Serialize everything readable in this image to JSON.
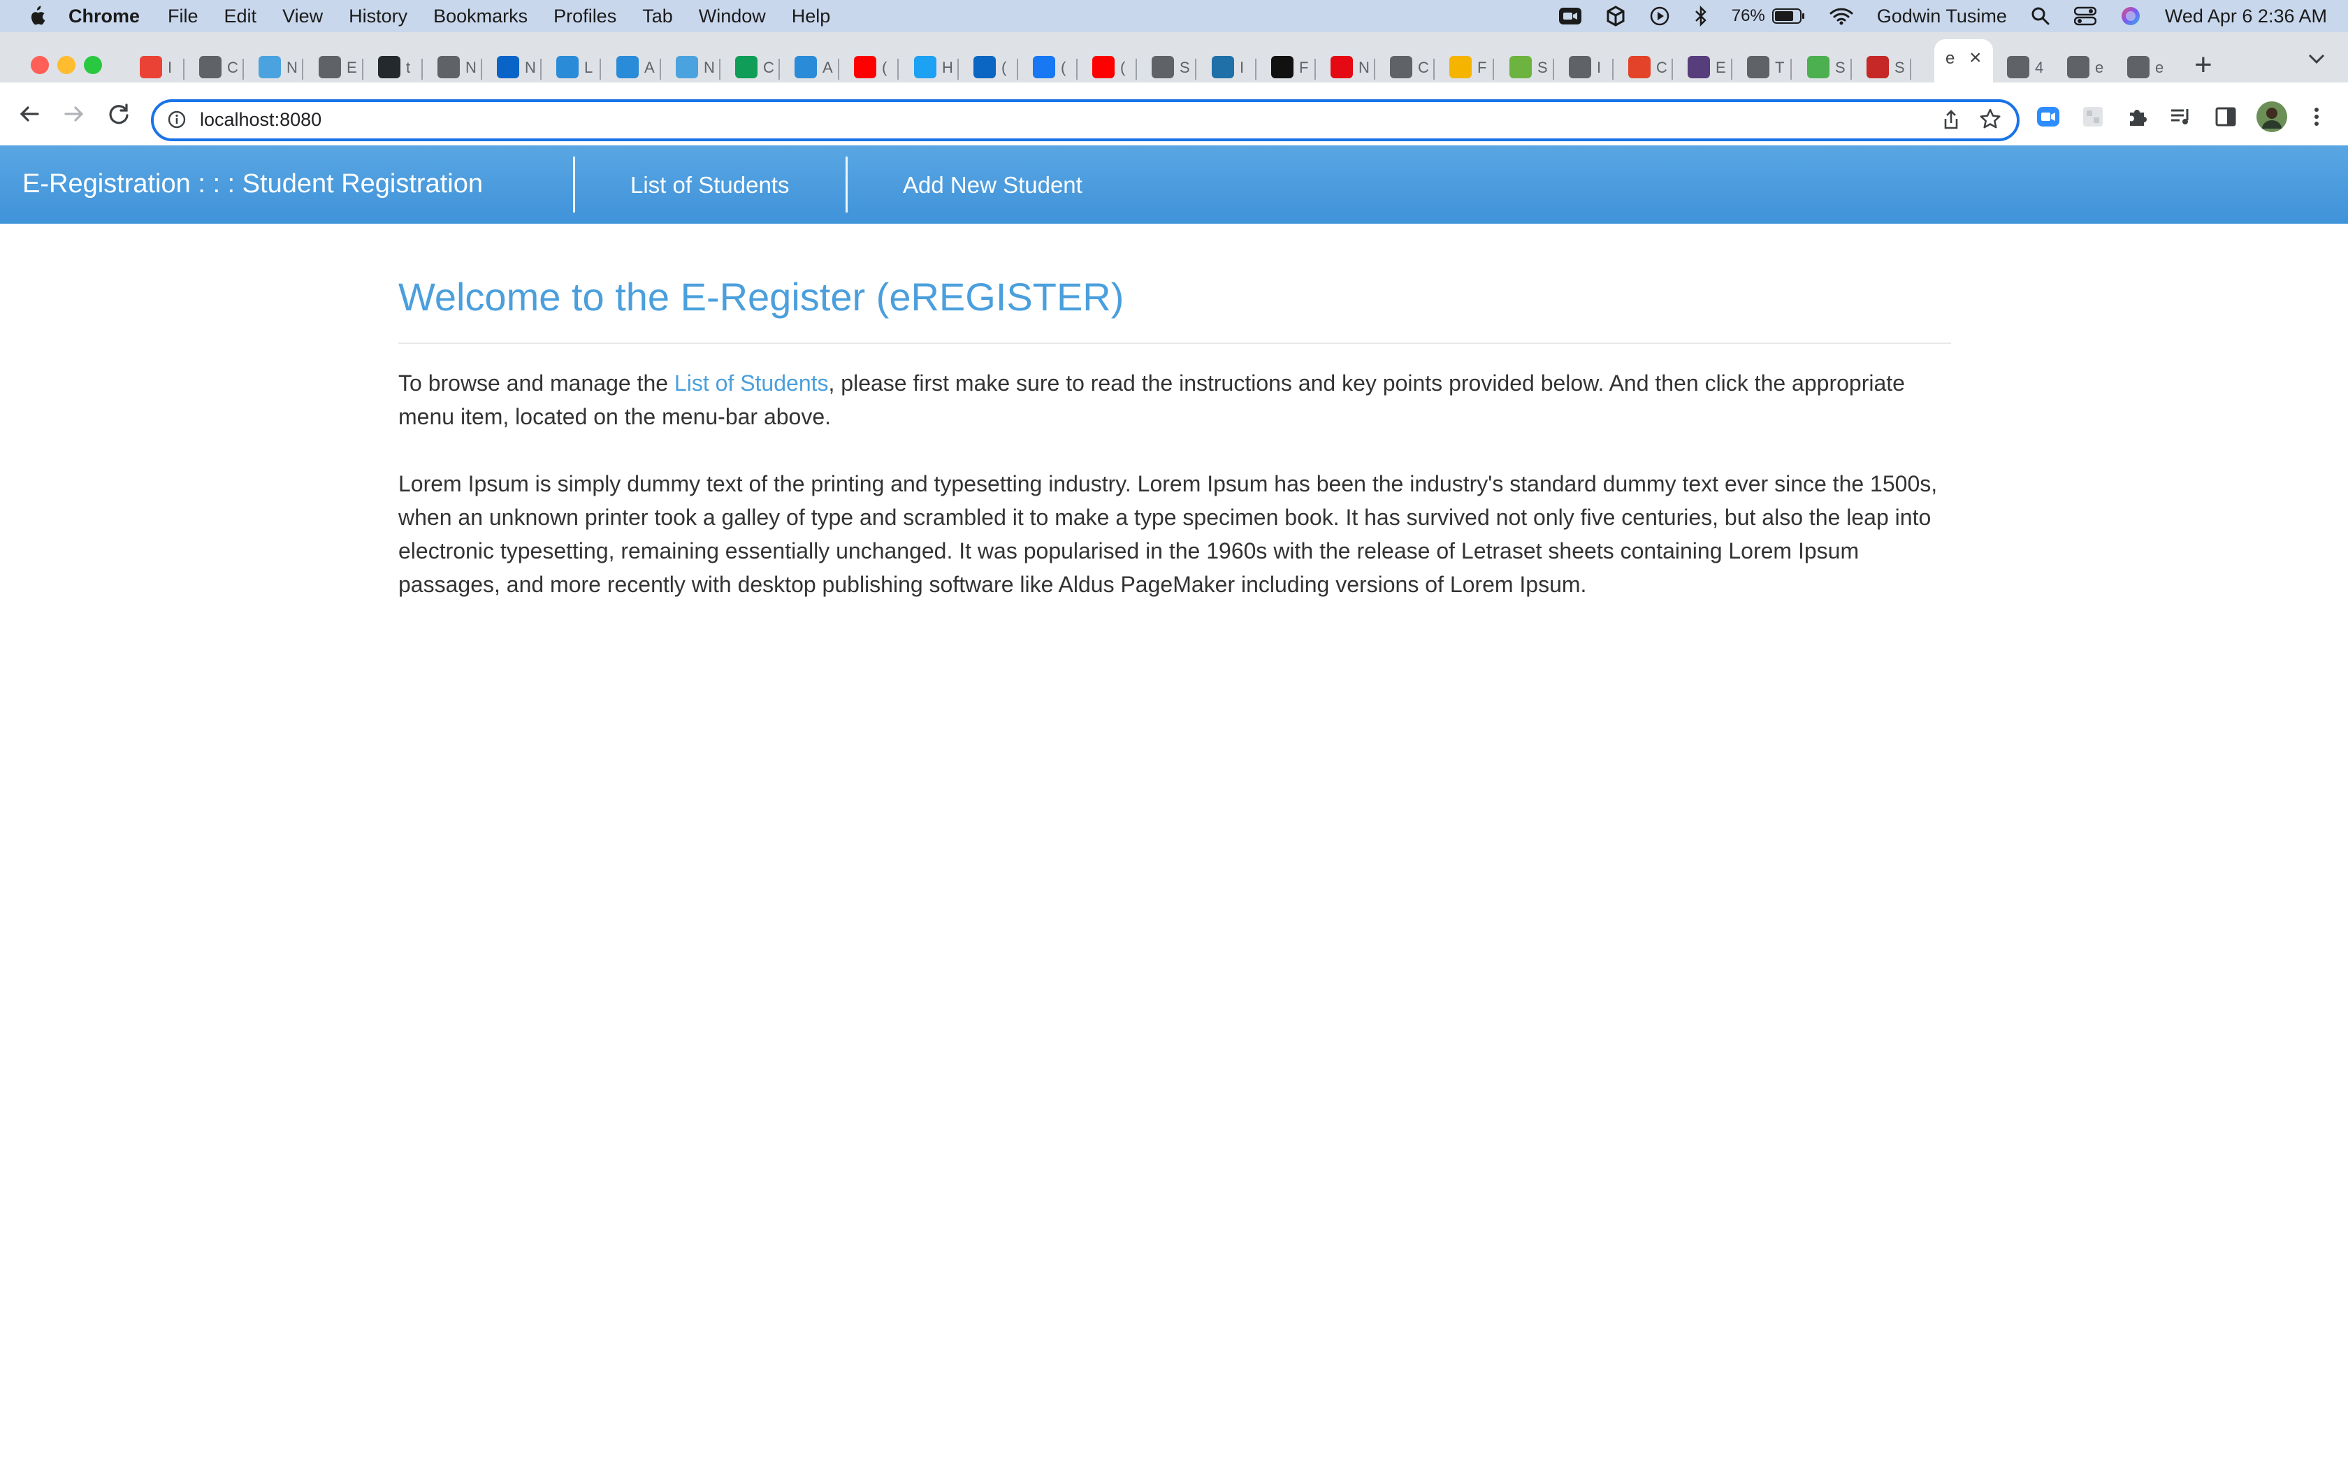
{
  "menubar": {
    "app_name": "Chrome",
    "items": [
      "File",
      "Edit",
      "View",
      "History",
      "Bookmarks",
      "Profiles",
      "Tab",
      "Window",
      "Help"
    ],
    "battery": "76%",
    "user_name": "Godwin Tusime",
    "datetime": "Wed Apr 6  2:36 AM"
  },
  "tabs": {
    "active_title": "e",
    "favicons": [
      {
        "icon": "gmail-icon",
        "letter": "I",
        "color": "#ea4335"
      },
      {
        "icon": "globe-icon",
        "letter": "C",
        "color": "#5f6368"
      },
      {
        "icon": "cloud-icon",
        "letter": "N",
        "color": "#4aa3df"
      },
      {
        "icon": "globe-icon",
        "letter": "E",
        "color": "#5f6368"
      },
      {
        "icon": "github-icon",
        "letter": "t",
        "color": "#24292e"
      },
      {
        "icon": "globe-icon",
        "letter": "N",
        "color": "#5f6368"
      },
      {
        "icon": "outlook-icon",
        "letter": "N",
        "color": "#0a64c8"
      },
      {
        "icon": "app-icon",
        "letter": "L",
        "color": "#2a8bd8"
      },
      {
        "icon": "app-icon",
        "letter": "A",
        "color": "#2a8bd8"
      },
      {
        "icon": "cloud-icon",
        "letter": "N",
        "color": "#4aa3df"
      },
      {
        "icon": "sheets-icon",
        "letter": "C",
        "color": "#0f9d58"
      },
      {
        "icon": "app-icon",
        "letter": "A",
        "color": "#2a8bd8"
      },
      {
        "icon": "youtube-icon",
        "letter": "(",
        "color": "#ff0000"
      },
      {
        "icon": "twitter-icon",
        "letter": "H",
        "color": "#1da1f2"
      },
      {
        "icon": "linkedin-icon",
        "letter": "(",
        "color": "#0a66c2"
      },
      {
        "icon": "facebook-icon",
        "letter": "(",
        "color": "#1877f2"
      },
      {
        "icon": "youtube-icon",
        "letter": "(",
        "color": "#ff0000"
      },
      {
        "icon": "globe-icon",
        "letter": "S",
        "color": "#5f6368"
      },
      {
        "icon": "video-icon",
        "letter": "I",
        "color": "#1f6fa8"
      },
      {
        "icon": "p-icon",
        "letter": "F",
        "color": "#111111"
      },
      {
        "icon": "netflix-icon",
        "letter": "N",
        "color": "#e50914"
      },
      {
        "icon": "globe-icon",
        "letter": "C",
        "color": "#5f6368"
      },
      {
        "icon": "g-icon",
        "letter": "F",
        "color": "#f4b400"
      },
      {
        "icon": "spring-icon",
        "letter": "S",
        "color": "#6db33f"
      },
      {
        "icon": "globe-icon",
        "letter": "I",
        "color": "#5f6368"
      },
      {
        "icon": "gitlab-icon",
        "letter": "C",
        "color": "#e24329"
      },
      {
        "icon": "bootstrap-icon",
        "letter": "E",
        "color": "#563d7c"
      },
      {
        "icon": "globe-icon",
        "letter": "T",
        "color": "#5f6368"
      },
      {
        "icon": "leaf-icon",
        "letter": "S",
        "color": "#4caf50"
      },
      {
        "icon": "app-icon",
        "letter": "S",
        "color": "#c62828"
      }
    ],
    "trailing": [
      {
        "icon": "globe-icon",
        "letter": "4",
        "color": "#5f6368"
      },
      {
        "icon": "globe-icon",
        "letter": "e",
        "color": "#5f6368"
      },
      {
        "icon": "globe-icon",
        "letter": "e",
        "color": "#5f6368"
      }
    ]
  },
  "address_bar": {
    "url": "localhost:8080"
  },
  "navbar": {
    "brand": "E-Registration : : : Student Registration",
    "links": [
      "List of Students",
      "Add New Student"
    ]
  },
  "page": {
    "heading": "Welcome to the E-Register (eREGISTER)",
    "para1_before": "To browse and manage the ",
    "para1_link": "List of Students",
    "para1_after": ", please first make sure to read the instructions and key points provided below. And then click the appropriate menu item, located on the menu-bar above.",
    "para2": "Lorem Ipsum is simply dummy text of the printing and typesetting industry. Lorem Ipsum has been the industry's standard dummy text ever since the 1500s, when an unknown printer took a galley of type and scrambled it to make a type specimen book. It has survived not only five centuries, but also the leap into electronic typesetting, remaining essentially unchanged. It was popularised in the 1960s with the release of Letraset sheets containing Lorem Ipsum passages, and more recently with desktop publishing software like Aldus PageMaker including versions of Lorem Ipsum."
  },
  "colors": {
    "navbar": "#4a9fdc",
    "heading": "#4a9fdc",
    "omnibox_focus": "#1a73e8"
  }
}
